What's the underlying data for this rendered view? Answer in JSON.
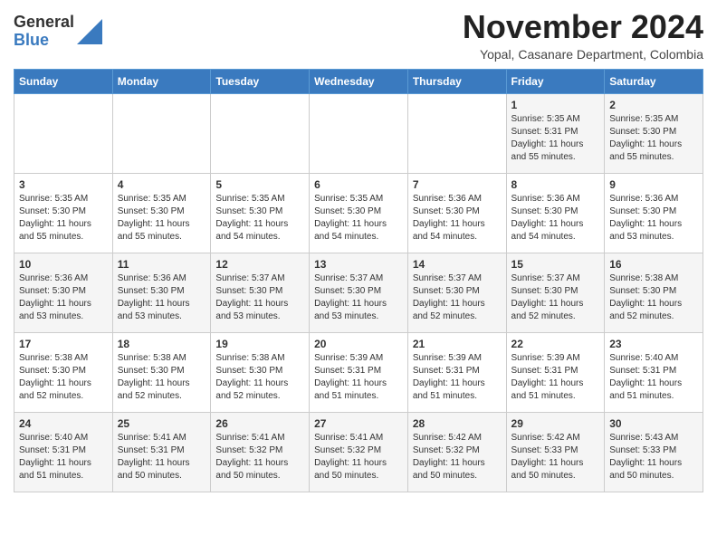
{
  "logo": {
    "general": "General",
    "blue": "Blue"
  },
  "title": "November 2024",
  "subtitle": "Yopal, Casanare Department, Colombia",
  "days_of_week": [
    "Sunday",
    "Monday",
    "Tuesday",
    "Wednesday",
    "Thursday",
    "Friday",
    "Saturday"
  ],
  "weeks": [
    [
      {
        "day": "",
        "info": ""
      },
      {
        "day": "",
        "info": ""
      },
      {
        "day": "",
        "info": ""
      },
      {
        "day": "",
        "info": ""
      },
      {
        "day": "",
        "info": ""
      },
      {
        "day": "1",
        "info": "Sunrise: 5:35 AM\nSunset: 5:31 PM\nDaylight: 11 hours\nand 55 minutes."
      },
      {
        "day": "2",
        "info": "Sunrise: 5:35 AM\nSunset: 5:30 PM\nDaylight: 11 hours\nand 55 minutes."
      }
    ],
    [
      {
        "day": "3",
        "info": "Sunrise: 5:35 AM\nSunset: 5:30 PM\nDaylight: 11 hours\nand 55 minutes."
      },
      {
        "day": "4",
        "info": "Sunrise: 5:35 AM\nSunset: 5:30 PM\nDaylight: 11 hours\nand 55 minutes."
      },
      {
        "day": "5",
        "info": "Sunrise: 5:35 AM\nSunset: 5:30 PM\nDaylight: 11 hours\nand 54 minutes."
      },
      {
        "day": "6",
        "info": "Sunrise: 5:35 AM\nSunset: 5:30 PM\nDaylight: 11 hours\nand 54 minutes."
      },
      {
        "day": "7",
        "info": "Sunrise: 5:36 AM\nSunset: 5:30 PM\nDaylight: 11 hours\nand 54 minutes."
      },
      {
        "day": "8",
        "info": "Sunrise: 5:36 AM\nSunset: 5:30 PM\nDaylight: 11 hours\nand 54 minutes."
      },
      {
        "day": "9",
        "info": "Sunrise: 5:36 AM\nSunset: 5:30 PM\nDaylight: 11 hours\nand 53 minutes."
      }
    ],
    [
      {
        "day": "10",
        "info": "Sunrise: 5:36 AM\nSunset: 5:30 PM\nDaylight: 11 hours\nand 53 minutes."
      },
      {
        "day": "11",
        "info": "Sunrise: 5:36 AM\nSunset: 5:30 PM\nDaylight: 11 hours\nand 53 minutes."
      },
      {
        "day": "12",
        "info": "Sunrise: 5:37 AM\nSunset: 5:30 PM\nDaylight: 11 hours\nand 53 minutes."
      },
      {
        "day": "13",
        "info": "Sunrise: 5:37 AM\nSunset: 5:30 PM\nDaylight: 11 hours\nand 53 minutes."
      },
      {
        "day": "14",
        "info": "Sunrise: 5:37 AM\nSunset: 5:30 PM\nDaylight: 11 hours\nand 52 minutes."
      },
      {
        "day": "15",
        "info": "Sunrise: 5:37 AM\nSunset: 5:30 PM\nDaylight: 11 hours\nand 52 minutes."
      },
      {
        "day": "16",
        "info": "Sunrise: 5:38 AM\nSunset: 5:30 PM\nDaylight: 11 hours\nand 52 minutes."
      }
    ],
    [
      {
        "day": "17",
        "info": "Sunrise: 5:38 AM\nSunset: 5:30 PM\nDaylight: 11 hours\nand 52 minutes."
      },
      {
        "day": "18",
        "info": "Sunrise: 5:38 AM\nSunset: 5:30 PM\nDaylight: 11 hours\nand 52 minutes."
      },
      {
        "day": "19",
        "info": "Sunrise: 5:38 AM\nSunset: 5:30 PM\nDaylight: 11 hours\nand 52 minutes."
      },
      {
        "day": "20",
        "info": "Sunrise: 5:39 AM\nSunset: 5:31 PM\nDaylight: 11 hours\nand 51 minutes."
      },
      {
        "day": "21",
        "info": "Sunrise: 5:39 AM\nSunset: 5:31 PM\nDaylight: 11 hours\nand 51 minutes."
      },
      {
        "day": "22",
        "info": "Sunrise: 5:39 AM\nSunset: 5:31 PM\nDaylight: 11 hours\nand 51 minutes."
      },
      {
        "day": "23",
        "info": "Sunrise: 5:40 AM\nSunset: 5:31 PM\nDaylight: 11 hours\nand 51 minutes."
      }
    ],
    [
      {
        "day": "24",
        "info": "Sunrise: 5:40 AM\nSunset: 5:31 PM\nDaylight: 11 hours\nand 51 minutes."
      },
      {
        "day": "25",
        "info": "Sunrise: 5:41 AM\nSunset: 5:31 PM\nDaylight: 11 hours\nand 50 minutes."
      },
      {
        "day": "26",
        "info": "Sunrise: 5:41 AM\nSunset: 5:32 PM\nDaylight: 11 hours\nand 50 minutes."
      },
      {
        "day": "27",
        "info": "Sunrise: 5:41 AM\nSunset: 5:32 PM\nDaylight: 11 hours\nand 50 minutes."
      },
      {
        "day": "28",
        "info": "Sunrise: 5:42 AM\nSunset: 5:32 PM\nDaylight: 11 hours\nand 50 minutes."
      },
      {
        "day": "29",
        "info": "Sunrise: 5:42 AM\nSunset: 5:33 PM\nDaylight: 11 hours\nand 50 minutes."
      },
      {
        "day": "30",
        "info": "Sunrise: 5:43 AM\nSunset: 5:33 PM\nDaylight: 11 hours\nand 50 minutes."
      }
    ]
  ]
}
